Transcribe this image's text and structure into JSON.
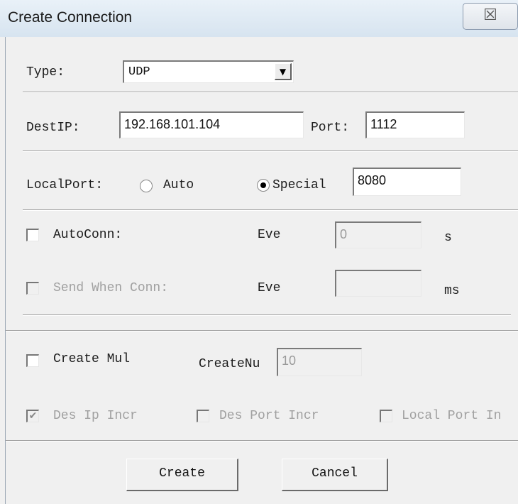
{
  "window": {
    "title": "Create Connection",
    "close_glyph": "☒"
  },
  "type_row": {
    "label": "Type:",
    "selected": "UDP"
  },
  "dest_row": {
    "label": "DestIP:",
    "ip": "192.168.101.104",
    "port_label": "Port:",
    "port": "1112"
  },
  "local_row": {
    "label": "LocalPort:",
    "auto_label": "Auto",
    "special_label": "Special",
    "port": "8080",
    "selected": "Special"
  },
  "auto_conn": {
    "label": "AutoConn:",
    "checked": false,
    "eve_label": "Eve",
    "value": "0",
    "unit": "s"
  },
  "send_when": {
    "label": "Send When Conn:",
    "checked": false,
    "enabled": false,
    "eve_label": "Eve",
    "value": "",
    "unit": "ms"
  },
  "create_mul": {
    "label": "Create Mul",
    "checked": false,
    "count_label": "CreateNu",
    "count": "10"
  },
  "increments": [
    {
      "label": "Des Ip Incr",
      "checked": true
    },
    {
      "label": "Des Port Incr",
      "checked": false
    },
    {
      "label": "Local Port In",
      "checked": false
    }
  ],
  "buttons": {
    "create": "Create",
    "cancel": "Cancel"
  }
}
